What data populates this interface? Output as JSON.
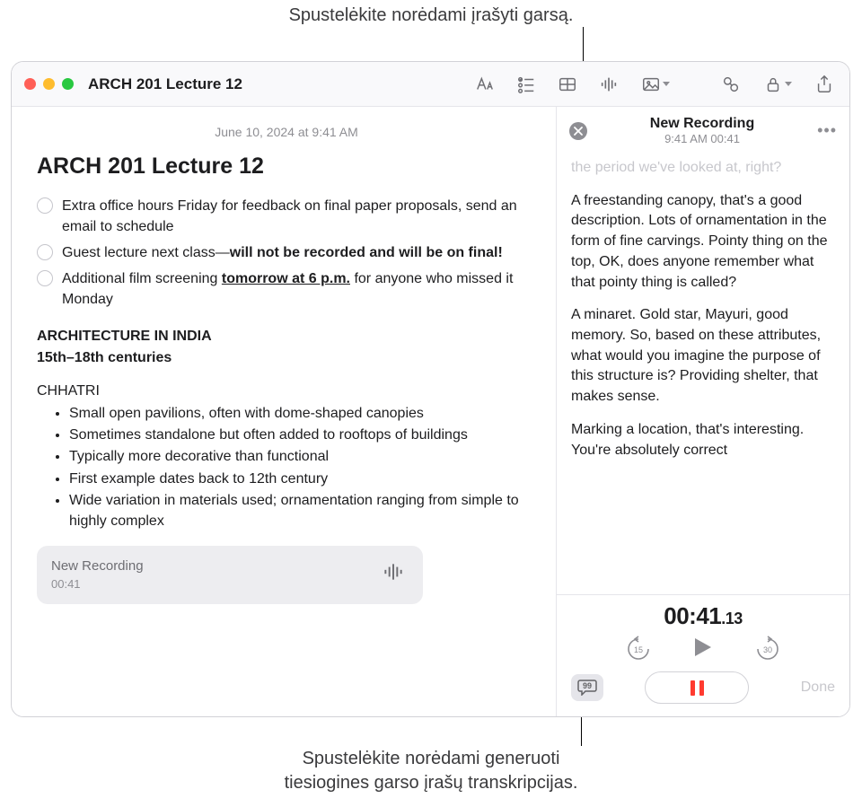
{
  "callouts": {
    "top": "Spustelėkite norėdami įrašyti garsą.",
    "bottom_line1": "Spustelėkite norėdami generuoti",
    "bottom_line2": "tiesiogines garso įrašų transkripcijas."
  },
  "window_title": "ARCH 201 Lecture 12",
  "note": {
    "date": "June 10, 2024 at 9:41 AM",
    "heading": "ARCH 201 Lecture 12",
    "checklist": [
      {
        "pre": "Extra office hours Friday for feedback on final paper proposals, send an email to schedule"
      },
      {
        "pre": "Guest lecture next class—",
        "bold": "will not be recorded and will be on final!"
      },
      {
        "pre": "Additional film screening ",
        "ul": "tomorrow at 6 p.m.",
        "post": " for anyone who missed it Monday"
      }
    ],
    "section_a": "ARCHITECTURE IN INDIA",
    "section_b": "15th–18th centuries",
    "subhead": "CHHATRI",
    "bullets": [
      "Small open pavilions, often with dome-shaped canopies",
      "Sometimes standalone but often added to rooftops of buildings",
      "Typically more decorative than functional",
      "First example dates back to 12th century",
      "Wide variation in materials used; ornamentation ranging from simple to highly complex"
    ],
    "chip": {
      "title": "New Recording",
      "duration": "00:41"
    }
  },
  "recording": {
    "title": "New Recording",
    "time_label": "9:41 AM 00:41",
    "faded_line": "the period we've looked at, right?",
    "p1": "A freestanding canopy, that's a good description. Lots of ornamentation in the form of fine carvings. Pointy thing on the top, OK, does anyone remember what that pointy thing is called?",
    "p2": "A minaret. Gold star, Mayuri, good memory. So, based on these attributes, what would you imagine the purpose of this structure is? Providing shelter, that makes sense.",
    "p3": "Marking a location, that's interesting. You're absolutely correct",
    "timecode_main": "00:41",
    "timecode_frac": ".13",
    "skip_back": "15",
    "skip_fwd": "30",
    "done": "Done"
  }
}
